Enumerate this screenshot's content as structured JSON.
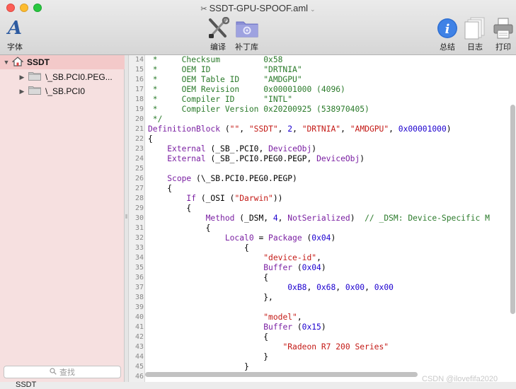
{
  "window": {
    "title": "SSDT-GPU-SPOOF.aml"
  },
  "toolbar": {
    "font_label": "字体",
    "compile_label": "编译",
    "patch_label": "补丁库",
    "summary_label": "总结",
    "log_label": "日志",
    "print_label": "打印"
  },
  "sidebar": {
    "items": [
      {
        "label": "SSDT",
        "expanded": true,
        "selected": true
      },
      {
        "label": "\\_SB.PCI0.PEG...",
        "expanded": false,
        "selected": false
      },
      {
        "label": "\\_SB.PCI0",
        "expanded": false,
        "selected": false
      }
    ],
    "search_placeholder": "查找"
  },
  "editor": {
    "line_numbers": [
      "14",
      "15",
      "16",
      "17",
      "18",
      "19",
      "20",
      "21",
      "22",
      "23",
      "24",
      "25",
      "26",
      "27",
      "28",
      "29",
      "30",
      "31",
      "32",
      "33",
      "34",
      "35",
      "36",
      "37",
      "38",
      "39",
      "40",
      "41",
      "42",
      "43",
      "44",
      "45",
      "46"
    ]
  },
  "status": {
    "text": "SSDT",
    "watermark": "CSDN @ilovefifa2020"
  },
  "colors": {
    "sidebar_bg": "#f6e0e0",
    "sidebar_selected": "#f3c9c9",
    "comment": "#2a7a2a",
    "keyword": "#7a1fa2",
    "string": "#c41a16",
    "number": "#1c00cf"
  }
}
